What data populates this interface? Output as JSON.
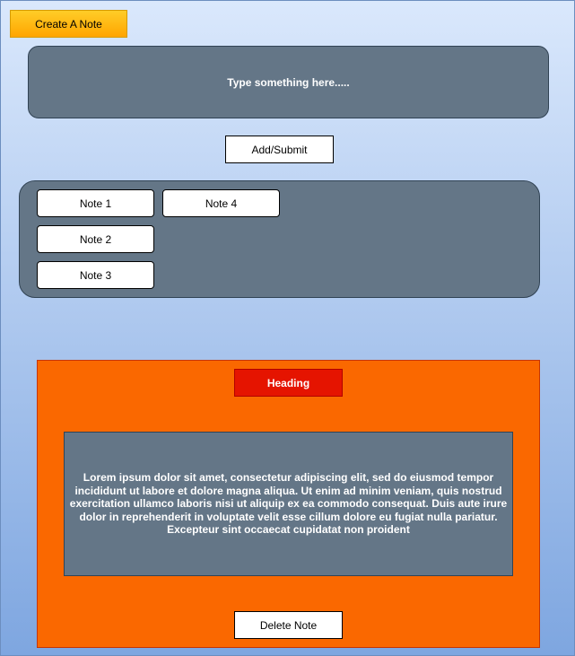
{
  "create_button": "Create A Note",
  "input": {
    "placeholder": "Type something here....."
  },
  "submit_button": "Add/Submit",
  "notes": [
    "Note 1",
    "Note 4",
    "Note 2",
    "Note 3"
  ],
  "detail": {
    "heading": "Heading",
    "body": "Lorem ipsum dolor sit amet, consectetur adipiscing elit, sed do eiusmod tempor incididunt ut labore et dolore magna aliqua. Ut enim ad minim veniam, quis nostrud exercitation ullamco laboris nisi ut aliquip ex ea commodo consequat. Duis aute irure dolor in reprehenderit in voluptate velit esse cillum dolore eu fugiat nulla pariatur. Excepteur sint occaecat cupidatat non proident",
    "delete_button": "Delete Note"
  },
  "colors": {
    "background_top": "#dae8fc",
    "background_bottom": "#7ea6e0",
    "create_button": "#ffcd28",
    "panel": "#647687",
    "detail_panel": "#fa6800",
    "heading": "#e51400"
  }
}
